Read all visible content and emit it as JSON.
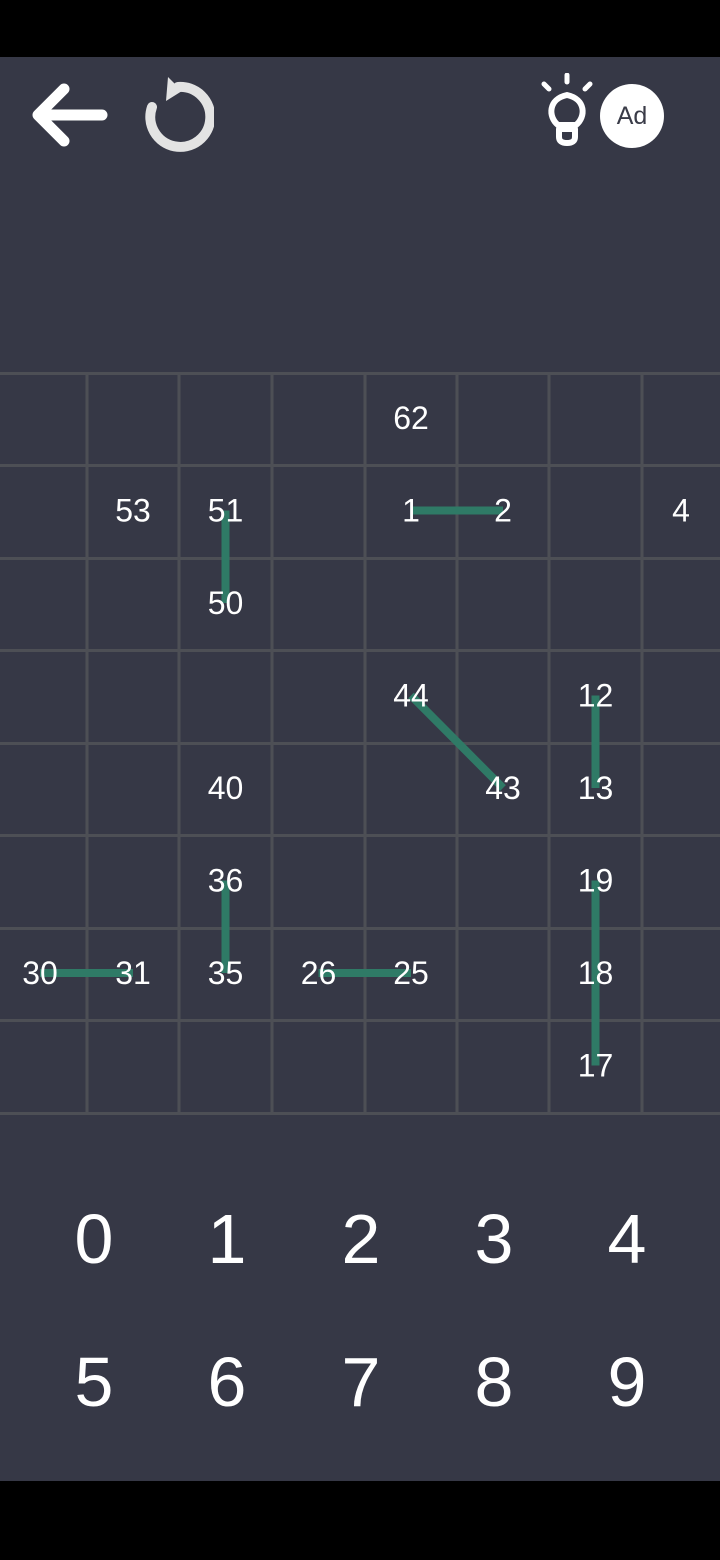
{
  "toolbar": {
    "back_icon": "arrow-left-icon",
    "undo_icon": "undo-icon",
    "hint_icon": "lightbulb-icon",
    "ad_label": "Ad"
  },
  "board": {
    "rows": 8,
    "cols": 8,
    "grid_color": "#4d4f55",
    "line_color": "#2f7a66",
    "text_color": "#ffffff",
    "cells": [
      {
        "r": 0,
        "c": 4,
        "v": "62"
      },
      {
        "r": 1,
        "c": 1,
        "v": "53"
      },
      {
        "r": 1,
        "c": 2,
        "v": "51"
      },
      {
        "r": 1,
        "c": 4,
        "v": "1"
      },
      {
        "r": 1,
        "c": 5,
        "v": "2"
      },
      {
        "r": 1,
        "c": 7,
        "v": "4"
      },
      {
        "r": 2,
        "c": 2,
        "v": "50"
      },
      {
        "r": 3,
        "c": 4,
        "v": "44"
      },
      {
        "r": 3,
        "c": 6,
        "v": "12"
      },
      {
        "r": 4,
        "c": 2,
        "v": "40"
      },
      {
        "r": 4,
        "c": 5,
        "v": "43"
      },
      {
        "r": 4,
        "c": 6,
        "v": "13"
      },
      {
        "r": 5,
        "c": 2,
        "v": "36"
      },
      {
        "r": 5,
        "c": 6,
        "v": "19"
      },
      {
        "r": 6,
        "c": 0,
        "v": "30"
      },
      {
        "r": 6,
        "c": 1,
        "v": "31"
      },
      {
        "r": 6,
        "c": 2,
        "v": "35"
      },
      {
        "r": 6,
        "c": 3,
        "v": "26"
      },
      {
        "r": 6,
        "c": 4,
        "v": "25"
      },
      {
        "r": 6,
        "c": 6,
        "v": "18"
      },
      {
        "r": 7,
        "c": 6,
        "v": "17"
      }
    ],
    "links": [
      [
        [
          1,
          4
        ],
        [
          1,
          5
        ]
      ],
      [
        [
          1,
          2
        ],
        [
          2,
          2
        ]
      ],
      [
        [
          3,
          4
        ],
        [
          4,
          5
        ]
      ],
      [
        [
          3,
          6
        ],
        [
          4,
          6
        ]
      ],
      [
        [
          5,
          2
        ],
        [
          6,
          2
        ]
      ],
      [
        [
          6,
          0
        ],
        [
          6,
          1
        ]
      ],
      [
        [
          6,
          3
        ],
        [
          6,
          4
        ]
      ],
      [
        [
          5,
          6
        ],
        [
          6,
          6
        ]
      ],
      [
        [
          6,
          6
        ],
        [
          7,
          6
        ]
      ]
    ]
  },
  "keypad": {
    "keys": [
      "0",
      "1",
      "2",
      "3",
      "4",
      "5",
      "6",
      "7",
      "8",
      "9"
    ]
  }
}
